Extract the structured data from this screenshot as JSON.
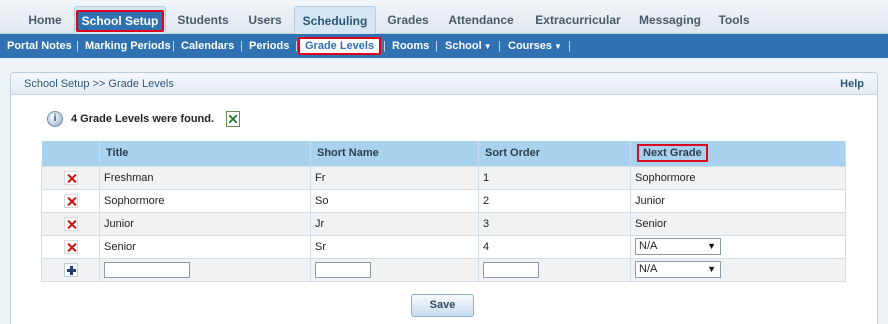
{
  "top_tabs": [
    {
      "label": "Home"
    },
    {
      "label": "School Setup"
    },
    {
      "label": "Students"
    },
    {
      "label": "Users"
    },
    {
      "label": "Scheduling"
    },
    {
      "label": "Grades"
    },
    {
      "label": "Attendance"
    },
    {
      "label": "Extracurricular"
    },
    {
      "label": "Messaging"
    },
    {
      "label": "Tools"
    }
  ],
  "sub_nav": {
    "items": [
      {
        "label": "Portal Notes"
      },
      {
        "label": "Marking Periods"
      },
      {
        "label": "Calendars"
      },
      {
        "label": "Periods"
      },
      {
        "label": "Grade Levels"
      },
      {
        "label": "Rooms"
      },
      {
        "label": "School"
      },
      {
        "label": "Courses"
      }
    ],
    "separator": "|"
  },
  "panel": {
    "breadcrumb": "School Setup >> Grade Levels",
    "help_label": "Help",
    "found_message": "4 Grade Levels were found."
  },
  "table": {
    "columns": [
      "Title",
      "Short Name",
      "Sort Order",
      "Next Grade"
    ],
    "rows": [
      {
        "title": "Freshman",
        "short_name": "Fr",
        "sort_order": "1",
        "next_grade": "Sophormore"
      },
      {
        "title": "Sophormore",
        "short_name": "So",
        "sort_order": "2",
        "next_grade": "Junior"
      },
      {
        "title": "Junior",
        "short_name": "Jr",
        "sort_order": "3",
        "next_grade": "Senior"
      },
      {
        "title": "Senior",
        "short_name": "Sr",
        "sort_order": "4",
        "next_grade": "N/A"
      }
    ],
    "new_row": {
      "title": "",
      "short_name": "",
      "sort_order": "",
      "next_grade": "N/A"
    }
  },
  "save_label": "Save",
  "icons": {
    "info": "info-icon",
    "export": "excel-export-icon",
    "delete": "delete-icon",
    "add": "add-icon",
    "dropdown": "dropdown-arrow-icon"
  },
  "colors": {
    "nav_blue": "#2f71b1",
    "table_header": "#a9d2ee",
    "highlight_red": "#e1001a"
  }
}
